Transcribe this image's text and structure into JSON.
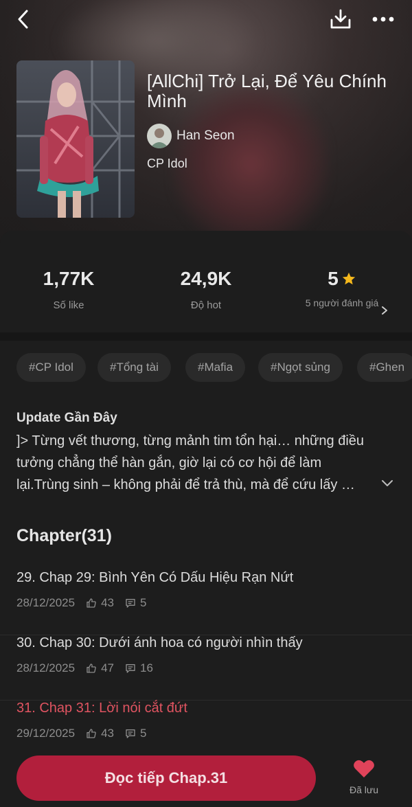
{
  "story": {
    "title": "[AllChi] Trở Lại, Để Yêu Chính Mình",
    "author": "Han Seon",
    "category": "CP Idol"
  },
  "stats": {
    "likes": {
      "value": "1,77K",
      "label": "Số like"
    },
    "hot": {
      "value": "24,9K",
      "label": "Độ hot"
    },
    "rating": {
      "value": "5",
      "label": "5 người đánh giá"
    }
  },
  "tags": [
    "#CP Idol",
    "#Tổng tài",
    "#Mafia",
    "#Ngọt sủng",
    "#Ghen"
  ],
  "update": {
    "heading": "Update Gần Đây",
    "text": "]> Từng vết thương, từng mảnh tim tổn hại… những điều tưởng chẳng thể hàn gắn, giờ lại có cơ hội để làm lại.Trùng sinh – không phải để trả thù, mà để cứu lấy …"
  },
  "chapters": {
    "heading": "Chapter(31)",
    "items": [
      {
        "title": "29. Chap 29: Bình Yên Có Dấu Hiệu Rạn Nứt",
        "date": "28/12/2025",
        "likes": "43",
        "comments": "5",
        "active": false
      },
      {
        "title": "30. Chap 30: Dưới ánh hoa có người nhìn thấy",
        "date": "28/12/2025",
        "likes": "47",
        "comments": "16",
        "active": false
      },
      {
        "title": "31. Chap 31: Lời nói cắt đứt",
        "date": "29/12/2025",
        "likes": "43",
        "comments": "5",
        "active": true
      }
    ]
  },
  "actions": {
    "read_continue": "Đọc tiếp Chap.31",
    "saved": "Đã lưu"
  },
  "colors": {
    "accent": "#b21f3c",
    "active_chapter": "#e05461",
    "star": "#f5b81c",
    "heart": "#e0435a"
  },
  "icons": [
    "back-icon",
    "download-icon",
    "more-icon",
    "star-icon",
    "chevron-right-icon",
    "chevron-down-icon",
    "like-icon",
    "comment-icon",
    "heart-icon"
  ]
}
